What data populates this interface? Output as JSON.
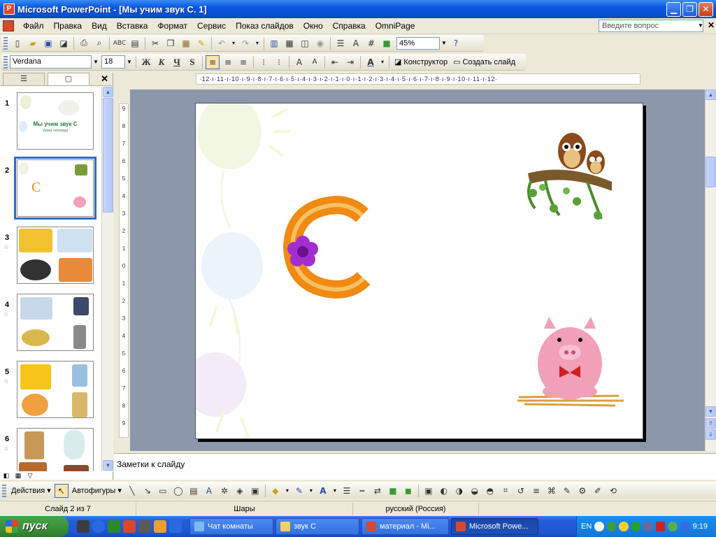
{
  "window": {
    "title": "Microsoft PowerPoint - [Мы учим звук С. 1]",
    "min_label": "▁",
    "max_label": "❐",
    "close_label": "✕"
  },
  "menu": {
    "items": [
      "Файл",
      "Правка",
      "Вид",
      "Вставка",
      "Формат",
      "Сервис",
      "Показ слайдов",
      "Окно",
      "Справка",
      "OmniPage"
    ],
    "help_placeholder": "Введите вопрос"
  },
  "toolbar": {
    "zoom": "45%",
    "font_name": "Verdana",
    "font_size": "18",
    "bold": "Ж",
    "italic": "К",
    "underline": "Ч",
    "shadow": "S",
    "designer_label": "Конструктор",
    "new_slide_label": "Создать слайд"
  },
  "left_panel": {
    "tab_outline": "☰",
    "tab_slides": "▢",
    "close": "✕",
    "slides": [
      {
        "num": "1",
        "title": "Мы учим звук С",
        "subtitle": "Уроки логопеда"
      },
      {
        "num": "2"
      },
      {
        "num": "3"
      },
      {
        "num": "4"
      },
      {
        "num": "5"
      },
      {
        "num": "6"
      }
    ]
  },
  "ruler": {
    "horizontal": "·12·ı·11·ı·10·ı·9·ı·8·ı·7·ı·6·ı·5·ı·4·ı·3·ı·2·ı·1·ı·0·ı·1·ı·2·ı·3·ı·4·ı·5·ı·6·ı·7·ı·8·ı·9·ı·10·ı·11·ı·12·",
    "vertical": [
      "9",
      "8",
      "7",
      "6",
      "5",
      "4",
      "3",
      "2",
      "1",
      "0",
      "1",
      "2",
      "3",
      "4",
      "5",
      "6",
      "7",
      "8",
      "9"
    ]
  },
  "slide": {
    "letter": "С"
  },
  "notes": {
    "placeholder": "Заметки к слайду"
  },
  "drawing_toolbar": {
    "actions_label": "Действия",
    "autoshapes_label": "Автофигуры"
  },
  "status": {
    "slide_counter": "Слайд 2 из 7",
    "design": "Шары",
    "language": "русский (Россия)"
  },
  "taskbar": {
    "start_label": "пуск",
    "buttons": [
      "Чат комнаты",
      "звук С",
      "материал - Mi...",
      "Microsoft Powe..."
    ],
    "lang": "EN",
    "clock": "9:19"
  },
  "colors": {
    "titlebar": "#0a58e0",
    "selection": "#316ac5",
    "letter_orange": "#f08a12",
    "flower_purple": "#8c1fb8",
    "pig_pink": "#f2a0b8"
  }
}
